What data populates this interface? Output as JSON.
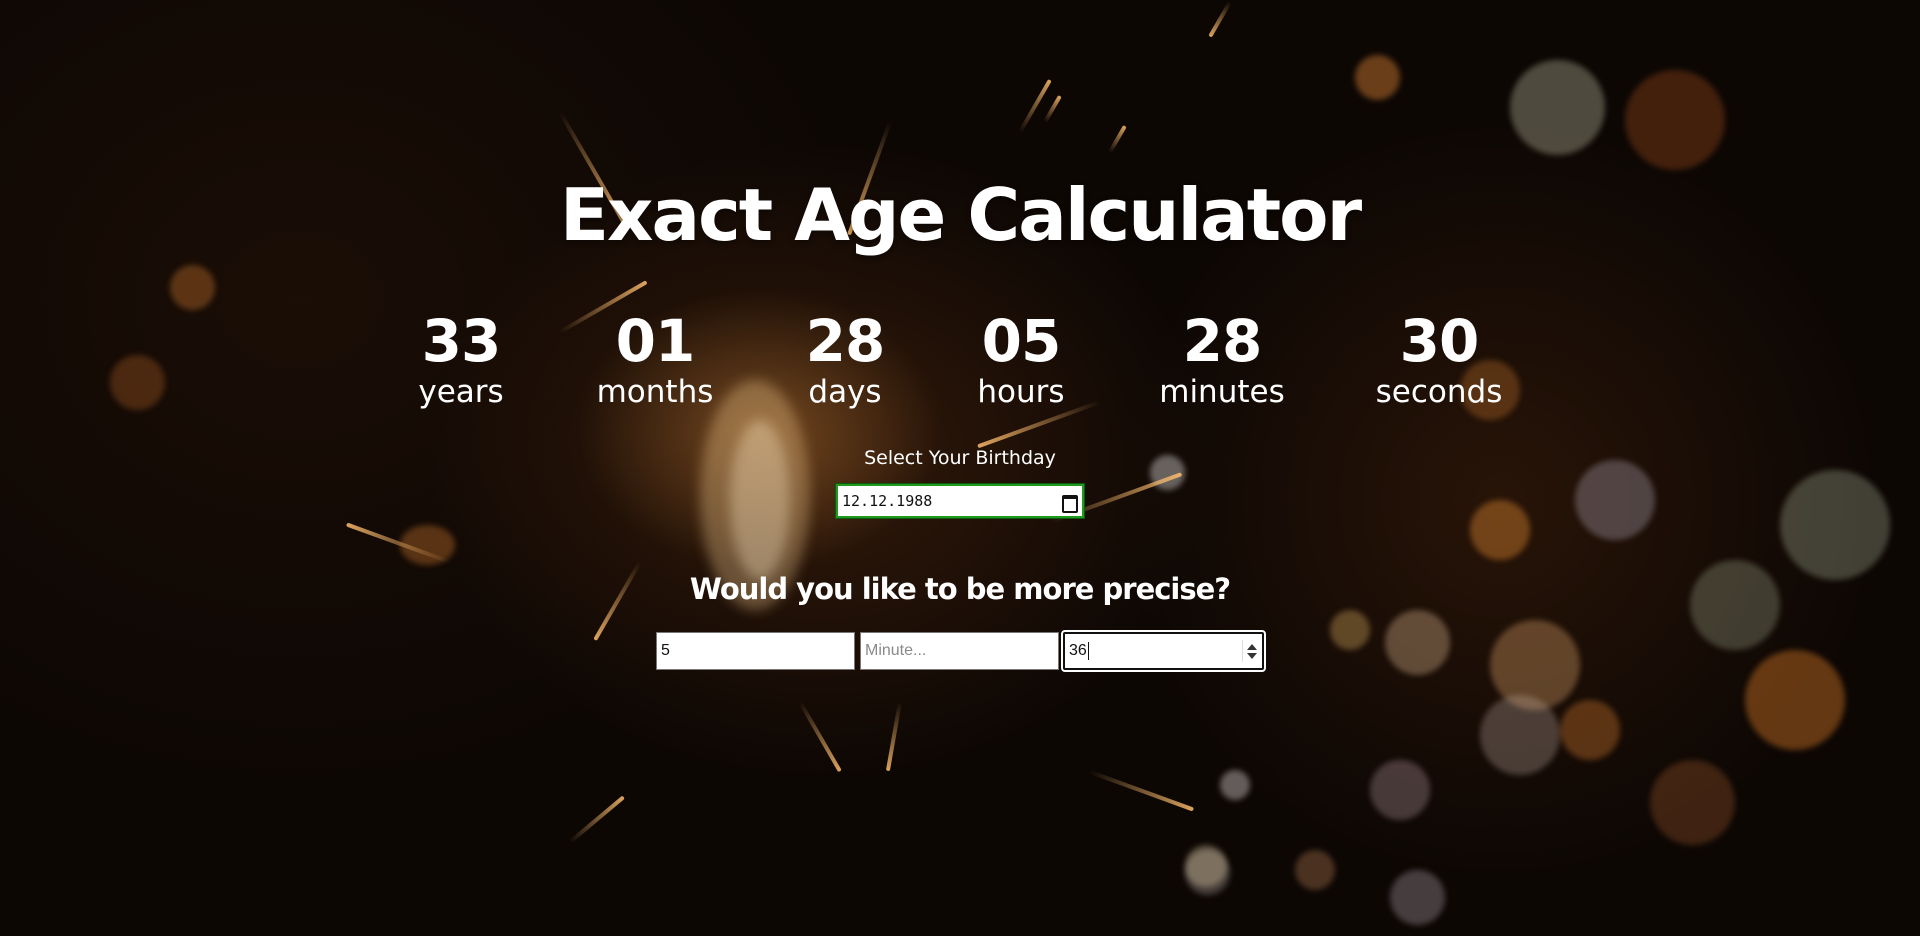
{
  "page": {
    "title": "Exact Age Calculator"
  },
  "age": [
    {
      "value": "33",
      "unit": "years"
    },
    {
      "value": "01",
      "unit": "months"
    },
    {
      "value": "28",
      "unit": "days"
    },
    {
      "value": "05",
      "unit": "hours"
    },
    {
      "value": "28",
      "unit": "minutes"
    },
    {
      "value": "30",
      "unit": "seconds"
    }
  ],
  "birthday": {
    "label": "Select Your Birthday",
    "value": "12.12.1988",
    "icon": "calendar-icon"
  },
  "precise": {
    "question": "Would you like to be more precise?",
    "hour_value": "5",
    "minute_placeholder": "Minute...",
    "minute_value": "",
    "second_value": "36"
  },
  "colors": {
    "text": "#ffffff",
    "date_border": "#1f9a1f",
    "background": "#0d0704"
  }
}
